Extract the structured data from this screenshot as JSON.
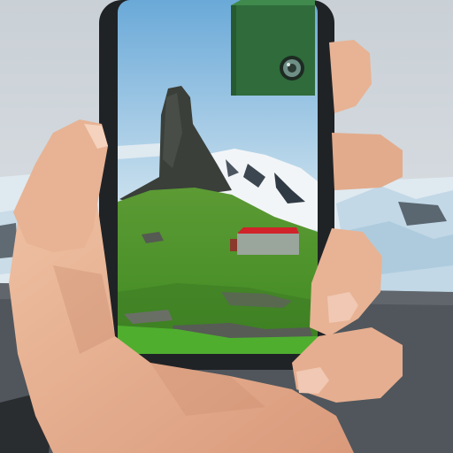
{
  "scene": {
    "colors": {
      "sky_top": "#c9d0d6",
      "sky_bottom": "#e4e8ea",
      "ice": "#dfe9f0",
      "ice_blue": "#a9c8dc",
      "road": "#50565c",
      "skin": "#e7b394",
      "skin_shadow": "#c98a6c",
      "phone_frame": "#202326",
      "screen_sky": "#8fc1e3",
      "grass": "#4f9a2e",
      "grass_dark": "#3d7a25",
      "rock": "#3a3f3a",
      "snow": "#f2f5f7",
      "hut_wall": "#9aa59c",
      "hut_roof": "#d0232a",
      "camera_box": "#2f6b3b"
    },
    "icons": [
      "camera-lens-icon"
    ]
  }
}
